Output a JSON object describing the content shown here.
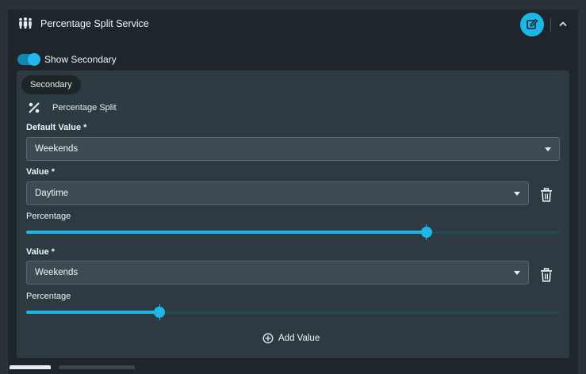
{
  "header": {
    "title": "Percentage Split Service",
    "icons": {
      "service": "people-group-icon",
      "edit": "edit-icon",
      "collapse": "chevron-up-icon"
    }
  },
  "toggle": {
    "label": "Show Secondary",
    "on": true
  },
  "secondary": {
    "chip": "Secondary",
    "split_label": "Percentage Split",
    "split_icon": "percent-icon",
    "default_value": {
      "label": "Default Value *",
      "value": "Weekends"
    },
    "values": [
      {
        "label": "Value *",
        "value": "Daytime",
        "percentage_label": "Percentage",
        "percentage": 75
      },
      {
        "label": "Value *",
        "value": "Weekends",
        "percentage_label": "Percentage",
        "percentage": 25
      }
    ],
    "add_label": "Add Value"
  },
  "colors": {
    "accent": "#1db6e6",
    "panel": "#1f262b",
    "inner": "#2e3a42",
    "input": "#3e4a52"
  }
}
